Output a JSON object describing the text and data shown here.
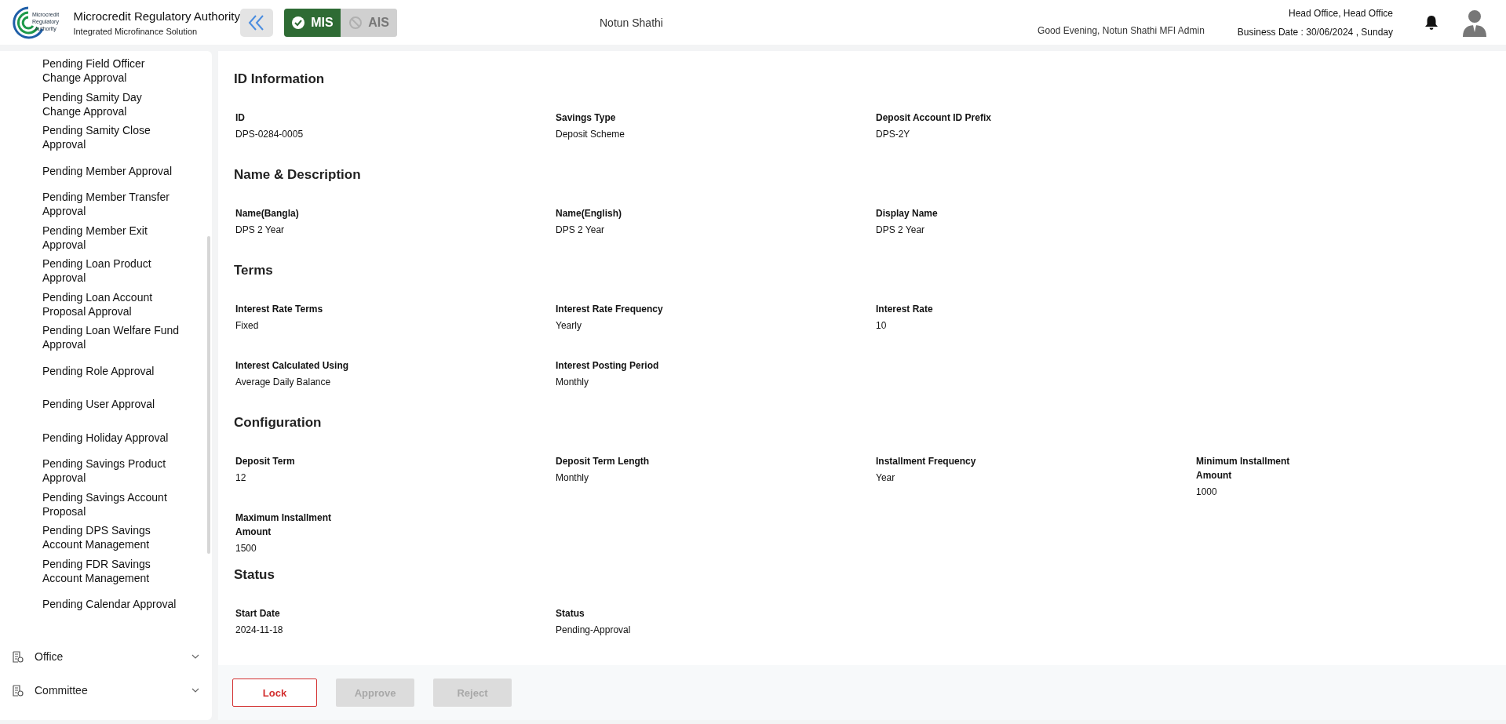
{
  "header": {
    "org_title": "Microcredit Regulatory Authority",
    "org_subtitle": "Integrated Microfinance Solution",
    "logo_text": "Microcredit Regulatory Authority",
    "modes": [
      {
        "label": "MIS",
        "selected": true
      },
      {
        "label": "AIS",
        "selected": false
      }
    ],
    "center_title": "Notun Shathi",
    "greeting": "Good Evening, Notun Shathi MFI Admin",
    "office": "Head Office, Head Office",
    "business_date": "Business Date : 30/06/2024 , Sunday"
  },
  "sidebar": {
    "items": [
      {
        "label": "Pending Field Officer Change Approval"
      },
      {
        "label": "Pending Samity Day Change Approval"
      },
      {
        "label": "Pending Samity Close Approval"
      },
      {
        "label": "Pending Member Approval"
      },
      {
        "label": "Pending Member Transfer Approval"
      },
      {
        "label": "Pending Member Exit Approval"
      },
      {
        "label": "Pending Loan Product Approval"
      },
      {
        "label": "Pending Loan Account Proposal Approval"
      },
      {
        "label": "Pending Loan Welfare Fund Approval"
      },
      {
        "label": "Pending Role Approval"
      },
      {
        "label": "Pending User Approval"
      },
      {
        "label": "Pending Holiday Approval"
      },
      {
        "label": "Pending Savings Product Approval"
      },
      {
        "label": "Pending Savings Account Proposal"
      },
      {
        "label": "Pending DPS Savings Account Management"
      },
      {
        "label": "Pending FDR Savings Account Management"
      },
      {
        "label": "Pending Calendar Approval"
      }
    ],
    "groups": [
      {
        "label": "Office",
        "expanded": false
      },
      {
        "label": "Committee",
        "expanded": false
      }
    ]
  },
  "sections": [
    {
      "title": "ID Information",
      "rows": [
        [
          {
            "label": "ID",
            "value": "DPS-0284-0005"
          },
          {
            "label": "Savings Type",
            "value": "Deposit Scheme"
          },
          {
            "label": "Deposit Account ID Prefix",
            "value": "DPS-2Y"
          }
        ]
      ]
    },
    {
      "title": "Name & Description",
      "rows": [
        [
          {
            "label": "Name(Bangla)",
            "value": "DPS 2 Year"
          },
          {
            "label": "Name(English)",
            "value": "DPS 2 Year"
          },
          {
            "label": "Display Name",
            "value": "DPS 2 Year"
          }
        ]
      ]
    },
    {
      "title": "Terms",
      "rows": [
        [
          {
            "label": "Interest Rate Terms",
            "value": "Fixed"
          },
          {
            "label": "Interest Rate Frequency",
            "value": "Yearly"
          },
          {
            "label": "Interest Rate",
            "value": "10"
          }
        ],
        [
          {
            "label": "Interest Calculated Using",
            "value": "Average Daily Balance"
          },
          {
            "label": "Interest Posting Period",
            "value": "Monthly"
          }
        ]
      ]
    },
    {
      "title": "Configuration",
      "rows": [
        [
          {
            "label": "Deposit Term",
            "value": "12"
          },
          {
            "label": "Deposit Term Length",
            "value": "Monthly"
          },
          {
            "label": "Installment Frequency",
            "value": "Year"
          },
          {
            "label": "Minimum Installment Amount",
            "value": "1000"
          }
        ],
        [
          {
            "label": "Maximum Installment Amount",
            "value": "1500"
          }
        ]
      ]
    },
    {
      "title": "Status",
      "rows": [
        [
          {
            "label": "Start Date",
            "value": "2024-11-18"
          },
          {
            "label": "Status",
            "value": "Pending-Approval"
          }
        ]
      ]
    }
  ],
  "actions": [
    {
      "label": "Lock",
      "kind": "outline",
      "disabled": false
    },
    {
      "label": "Approve",
      "kind": "solid",
      "disabled": true
    },
    {
      "label": "Reject",
      "kind": "solid",
      "disabled": true
    }
  ]
}
